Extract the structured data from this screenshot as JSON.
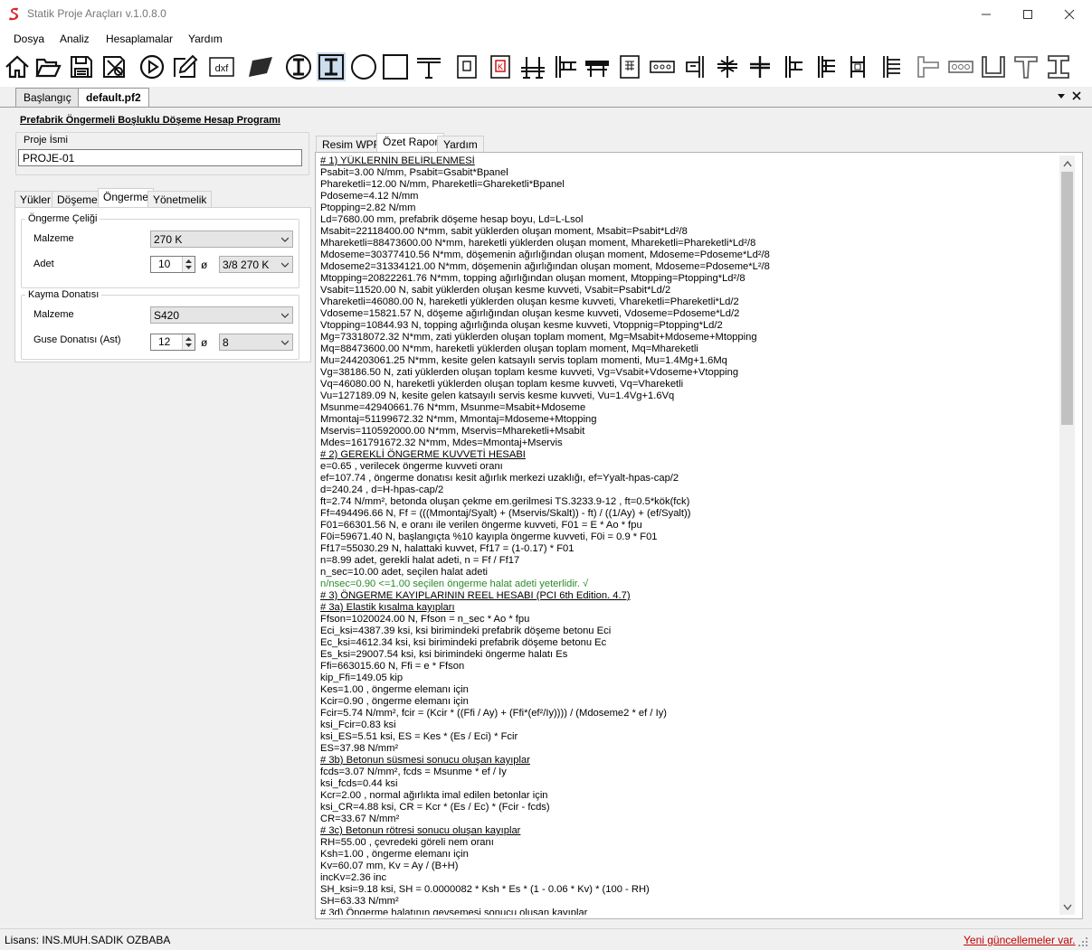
{
  "window": {
    "title": "Statik Proje Araçları v.1.0.8.0",
    "logo_color": "#d8232a",
    "controls": [
      "minimize-icon",
      "maximize-icon",
      "close-icon"
    ]
  },
  "menu": [
    "Dosya",
    "Analiz",
    "Hesaplamalar",
    "Yardım"
  ],
  "toolbar_icons": [
    "home-icon",
    "open-folder-icon",
    "save-icon",
    "settings-document-icon",
    "play-icon",
    "edit-pencil-icon",
    "dxf-icon",
    "panel-icon",
    "i-beam-circle-icon",
    "i-beam-square-icon",
    "circle-section-icon",
    "square-section-icon",
    "t-beam-icon",
    "column-icon",
    "column-k-icon",
    "beam-joint-icon",
    "beam-corbel-icon",
    "table-beam-icon",
    "column-grid-icon",
    "hollow-core-slab-icon",
    "corbel-icon",
    "double-beam-icon",
    "beam-end-icon",
    "column-corbel-icon",
    "column-double-corbel-icon",
    "column-bracket-icon",
    "column-multi-bracket-icon",
    "slab-step-icon",
    "hollow-slab-icon",
    "u-section-icon",
    "t-section-icon",
    "i-section-icon"
  ],
  "doc_tabs": {
    "start": "Başlangıç",
    "current": "default.pf2"
  },
  "program_title": "Prefabrik Öngermeli Boşluklu Döşeme Hesap Programı",
  "project": {
    "label": "Proje İsmi",
    "value": "PROJE-01"
  },
  "left_tabs": [
    "Yükler",
    "Döşeme",
    "Öngerme",
    "Yönetmelik"
  ],
  "active_left_tab": "Öngerme",
  "prestress_steel": {
    "group_label": "Öngerme Çeliği",
    "material_label": "Malzeme",
    "material_value": "270 K",
    "count_label": "Adet",
    "count_value": "10",
    "phi": "ø",
    "strand_value": "3/8 270 K"
  },
  "shear_reinf": {
    "group_label": "Kayma Donatısı",
    "material_label": "Malzeme",
    "material_value": "S420",
    "rebar_label": "Guse Donatısı (Ast)",
    "rebar_count": "12",
    "phi": "ø",
    "rebar_dia": "8"
  },
  "right_tabs": [
    "Resim WPF",
    "Özet Rapor",
    "Yardım"
  ],
  "active_right_tab": "Özet Rapor",
  "report_lines": [
    {
      "t": "# 1) YÜKLERNİN BELİRLENMESİ",
      "k": "h"
    },
    {
      "t": "Psabit=3.00 N/mm, Psabit=Gsabit*Bpanel",
      "k": ""
    },
    {
      "t": "Phareketli=12.00 N/mm, Phareketli=Ghareketli*Bpanel",
      "k": ""
    },
    {
      "t": "Pdoseme=4.12 N/mm",
      "k": ""
    },
    {
      "t": "Ptopping=2.82 N/mm",
      "k": ""
    },
    {
      "t": "Ld=7680.00 mm, prefabrik döşeme hesap boyu, Ld=L-Lsol",
      "k": ""
    },
    {
      "t": "Msabit=22118400.00 N*mm, sabit yüklerden oluşan moment, Msabit=Psabit*Ld²/8",
      "k": ""
    },
    {
      "t": "Mhareketli=88473600.00 N*mm, hareketli yüklerden oluşan moment, Mhareketli=Phareketli*Ld²/8",
      "k": ""
    },
    {
      "t": "Mdoseme=30377410.56 N*mm, döşemenin ağırlığından oluşan moment, Mdoseme=Pdoseme*Ld²/8",
      "k": ""
    },
    {
      "t": "Mdoseme2=31334121.00 N*mm, döşemenin ağırlığından oluşan moment, Mdoseme=Pdoseme*L²/8",
      "k": ""
    },
    {
      "t": "Mtopping=20822261.76 N*mm, topping ağırlığından oluşan moment, Mtopping=Ptopping*Ld²/8",
      "k": ""
    },
    {
      "t": "Vsabit=11520.00 N, sabit yüklerden oluşan kesme kuvveti, Vsabit=Psabit*Ld/2",
      "k": ""
    },
    {
      "t": "Vhareketli=46080.00 N, hareketli yüklerden oluşan kesme kuvveti, Vhareketli=Phareketli*Ld/2",
      "k": ""
    },
    {
      "t": "Vdoseme=15821.57 N, döşeme ağırlığından oluşan kesme kuvveti, Vdoseme=Pdoseme*Ld/2",
      "k": ""
    },
    {
      "t": "Vtopping=10844.93 N, topping ağırlığında oluşan kesme kuvveti, Vtoppnig=Ptopping*Ld/2",
      "k": ""
    },
    {
      "t": "Mg=73318072.32 N*mm, zati yüklerden oluşan toplam moment, Mg=Msabit+Mdoseme+Mtopping",
      "k": ""
    },
    {
      "t": "Mq=88473600.00 N*mm, hareketli yüklerden oluşan toplam moment, Mq=Mhareketli",
      "k": ""
    },
    {
      "t": "Mu=244203061.25 N*mm, kesite gelen katsayılı servis toplam momenti, Mu=1.4Mg+1.6Mq",
      "k": ""
    },
    {
      "t": "Vg=38186.50 N, zati yüklerden oluşan toplam kesme kuvveti, Vg=Vsabit+Vdoseme+Vtopping",
      "k": ""
    },
    {
      "t": "Vq=46080.00 N, hareketli yüklerden oluşan toplam kesme kuvveti, Vq=Vhareketli",
      "k": ""
    },
    {
      "t": "Vu=127189.09 N, kesite gelen katsayılı servis kesme kuvveti, Vu=1.4Vg+1.6Vq",
      "k": ""
    },
    {
      "t": "Msunme=42940661.76 N*mm, Msunme=Msabit+Mdoseme",
      "k": ""
    },
    {
      "t": "Mmontaj=51199672.32 N*mm, Mmontaj=Mdoseme+Mtopping",
      "k": ""
    },
    {
      "t": "Mservis=110592000.00 N*mm, Mservis=Mhareketli+Msabit",
      "k": ""
    },
    {
      "t": "Mdes=161791672.32 N*mm, Mdes=Mmontaj+Mservis",
      "k": ""
    },
    {
      "t": "# 2) GEREKLİ ÖNGERME KUVVETİ HESABI",
      "k": "h"
    },
    {
      "t": "e=0.65 , verilecek öngerme kuvveti oranı",
      "k": ""
    },
    {
      "t": "ef=107.74 , öngerme donatısı kesit ağırlık merkezi uzaklığı, ef=Yyalt-hpas-cap/2",
      "k": ""
    },
    {
      "t": "d=240.24 , d=H-hpas-cap/2",
      "k": ""
    },
    {
      "t": "ft=2.74 N/mm², betonda oluşan çekme em.gerilmesi TS.3233.9-12 , ft=0.5*kök(fck)",
      "k": ""
    },
    {
      "t": "Ff=494496.66 N, Ff = (((Mmontaj/Syalt) + (Mservis/Skalt)) - ft) / ((1/Ay) + (ef/Syalt))",
      "k": ""
    },
    {
      "t": "F01=66301.56 N, e oranı ile verilen öngerme kuvveti, F01 = E * Ao * fpu",
      "k": ""
    },
    {
      "t": "F0i=59671.40 N, başlangıçta %10 kayıpla öngerme kuvveti, F0i = 0.9 * F01",
      "k": ""
    },
    {
      "t": "Ff17=55030.29 N, halattaki kuvvet, Ff17 = (1-0.17) * F01",
      "k": ""
    },
    {
      "t": "n=8.99 adet, gerekli halat adeti, n = Ff / Ff17",
      "k": ""
    },
    {
      "t": "n_sec=10.00 adet, seçilen halat adeti",
      "k": ""
    },
    {
      "t": "n/nsec=0.90 <=1.00 seçilen öngerme halat adeti yeterlidir. √",
      "k": "ok"
    },
    {
      "t": "# 3) ÖNGERME KAYIPLARININ REEL HESABI (PCI 6th Edition. 4.7)",
      "k": "h"
    },
    {
      "t": "# 3a) Elastik kısalma kayıpları",
      "k": "h"
    },
    {
      "t": "Ffson=1020024.00 N, Ffson = n_sec * Ao * fpu",
      "k": ""
    },
    {
      "t": "Eci_ksi=4387.39 ksi, ksi birimindeki prefabrik döşeme betonu Eci",
      "k": ""
    },
    {
      "t": "Ec_ksi=4612.34 ksi, ksi birimindeki prefabrik döşeme betonu Ec",
      "k": ""
    },
    {
      "t": "Es_ksi=29007.54 ksi, ksi birimindeki öngerme halatı Es",
      "k": ""
    },
    {
      "t": "Ffi=663015.60 N, Ffi = e * Ffson",
      "k": ""
    },
    {
      "t": "kip_Ffi=149.05 kip",
      "k": ""
    },
    {
      "t": "Kes=1.00 , öngerme elemanı için",
      "k": ""
    },
    {
      "t": "Kcir=0.90 , öngerme elemanı için",
      "k": ""
    },
    {
      "t": "Fcir=5.74 N/mm², fcir = (Kcir * ((Ffi / Ay) + (Ffi*(ef²/Iy)))) / (Mdoseme2 * ef / Iy)",
      "k": ""
    },
    {
      "t": "ksi_Fcir=0.83 ksi",
      "k": ""
    },
    {
      "t": "ksi_ES=5.51 ksi, ES = Kes * (Es / Eci) * Fcir",
      "k": ""
    },
    {
      "t": "ES=37.98 N/mm²",
      "k": ""
    },
    {
      "t": "# 3b) Betonun süsmesi sonucu oluşan kayıplar",
      "k": "h"
    },
    {
      "t": "fcds=3.07 N/mm², fcds = Msunme * ef / Iy",
      "k": ""
    },
    {
      "t": "ksi_fcds=0.44 ksi",
      "k": ""
    },
    {
      "t": "Kcr=2.00 , normal ağırlıkta imal edilen betonlar için",
      "k": ""
    },
    {
      "t": "ksi_CR=4.88 ksi, CR = Kcr * (Es / Ec) * (Fcir - fcds)",
      "k": ""
    },
    {
      "t": "CR=33.67 N/mm²",
      "k": ""
    },
    {
      "t": "# 3c) Betonun rötresi sonucu oluşan kayıplar",
      "k": "h"
    },
    {
      "t": "RH=55.00 , çevredeki göreli nem oranı",
      "k": ""
    },
    {
      "t": "Ksh=1.00 , öngerme elemanı için",
      "k": ""
    },
    {
      "t": "Kv=60.07 mm, Kv = Ay / (B+H)",
      "k": ""
    },
    {
      "t": "incKv=2.36 inc",
      "k": ""
    },
    {
      "t": "SH_ksi=9.18 ksi, SH = 0.0000082 * Ksh * Es * (1 - 0.06 * Kv) * (100 - RH)",
      "k": ""
    },
    {
      "t": "SH=63.33 N/mm²",
      "k": ""
    },
    {
      "t": "# 3d) Öngerme halatının gevşemesi sonucu oluşan kayıplar",
      "k": "h"
    }
  ],
  "status": {
    "license": "Lisans: INS.MUH.SADIK OZBABA",
    "update": "Yeni güncellemeler var."
  },
  "colors": {
    "ok_text": "#2a8a2a",
    "link": "#c00000",
    "panel_bg": "#f0f0f0"
  }
}
